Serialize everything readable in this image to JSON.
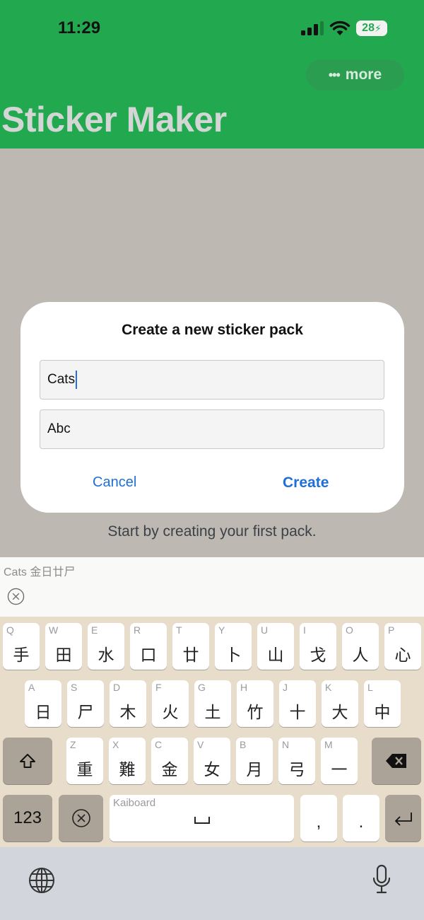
{
  "status": {
    "time": "11:29",
    "battery": "28"
  },
  "header": {
    "title": "Sticker Maker",
    "more_label": "more"
  },
  "dialog": {
    "title": "Create a new sticker pack",
    "name_value": "Cats",
    "author_value": "Abc",
    "cancel_label": "Cancel",
    "create_label": "Create"
  },
  "hint": "Start by creating your first pack.",
  "candidates": {
    "text": "Cats  金日廿尸"
  },
  "keyboard": {
    "row1": [
      {
        "l": "Q",
        "c": "手"
      },
      {
        "l": "W",
        "c": "田"
      },
      {
        "l": "E",
        "c": "水"
      },
      {
        "l": "R",
        "c": "口"
      },
      {
        "l": "T",
        "c": "廿"
      },
      {
        "l": "Y",
        "c": "卜"
      },
      {
        "l": "U",
        "c": "山"
      },
      {
        "l": "I",
        "c": "戈"
      },
      {
        "l": "O",
        "c": "人"
      },
      {
        "l": "P",
        "c": "心"
      }
    ],
    "row2": [
      {
        "l": "A",
        "c": "日"
      },
      {
        "l": "S",
        "c": "尸"
      },
      {
        "l": "D",
        "c": "木"
      },
      {
        "l": "F",
        "c": "火"
      },
      {
        "l": "G",
        "c": "土"
      },
      {
        "l": "H",
        "c": "竹"
      },
      {
        "l": "J",
        "c": "十"
      },
      {
        "l": "K",
        "c": "大"
      },
      {
        "l": "L",
        "c": "中"
      }
    ],
    "row3": [
      {
        "l": "Z",
        "c": "重"
      },
      {
        "l": "X",
        "c": "難"
      },
      {
        "l": "C",
        "c": "金"
      },
      {
        "l": "V",
        "c": "女"
      },
      {
        "l": "B",
        "c": "月"
      },
      {
        "l": "N",
        "c": "弓"
      },
      {
        "l": "M",
        "c": "一"
      }
    ],
    "numbers_label": "123",
    "space_label": "Kaiboard",
    "comma": ",",
    "period": "."
  }
}
